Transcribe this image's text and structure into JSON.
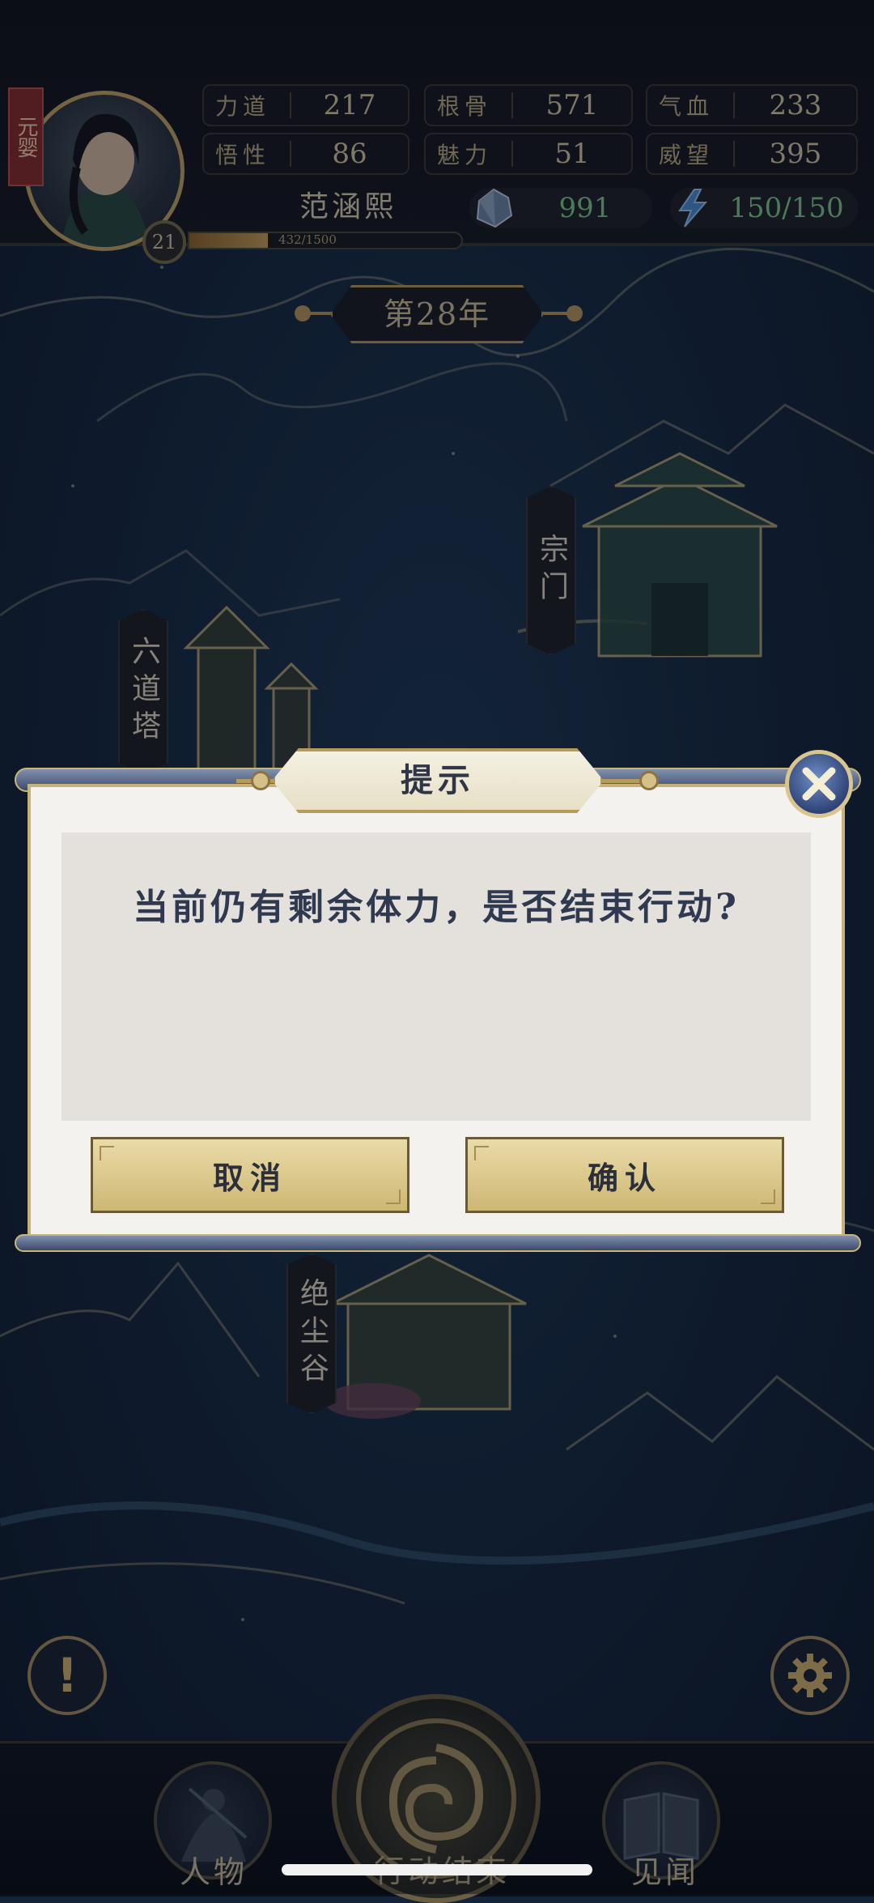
{
  "header": {
    "realm": "元婴",
    "level": "21",
    "exp_text": "432/1500",
    "exp_progress": 0.288,
    "player_name": "范涵熙",
    "stats": [
      {
        "label": "力道",
        "value": "217"
      },
      {
        "label": "根骨",
        "value": "571"
      },
      {
        "label": "气血",
        "value": "233"
      },
      {
        "label": "悟性",
        "value": "86"
      },
      {
        "label": "魅力",
        "value": "51"
      },
      {
        "label": "威望",
        "value": "395"
      }
    ],
    "spirit_stones": "991",
    "stamina": "150/150"
  },
  "map": {
    "year": "第28年",
    "locations": [
      {
        "name": "宗门"
      },
      {
        "name": "六道塔"
      },
      {
        "name": "绝尘谷"
      }
    ]
  },
  "dialog": {
    "title": "提示",
    "message": "当前仍有剩余体力，是否结束行动?",
    "cancel_label": "取消",
    "confirm_label": "确认"
  },
  "bottom_nav": {
    "character_label": "人物",
    "action_label": "行动结束",
    "journal_label": "见闻"
  },
  "colors": {
    "accent_gold": "#c4a86a",
    "resource_green": "#7fd08a",
    "map_blue": "#13233a",
    "dialog_text": "#2f3950"
  }
}
